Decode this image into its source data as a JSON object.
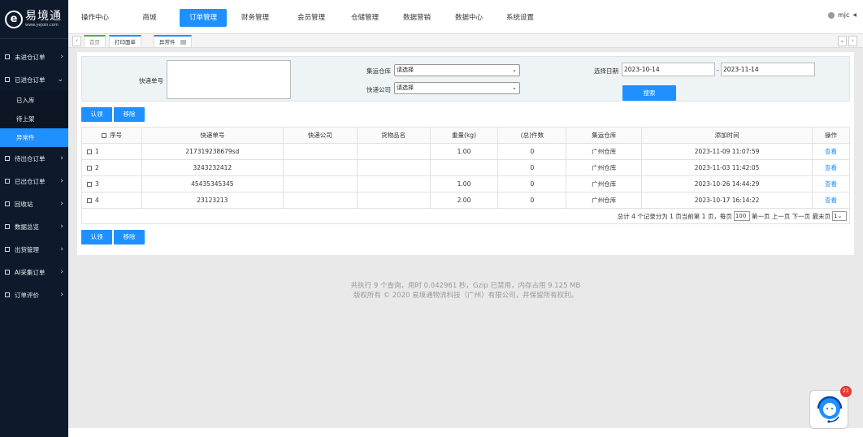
{
  "brand": {
    "name": "易境通",
    "url": "www.yejoin.com",
    "mark": "e"
  },
  "sidebar": {
    "items": [
      {
        "label": "未进仓订单"
      },
      {
        "label": "已进仓订单",
        "expanded": true,
        "subitems": [
          {
            "label": "已入库"
          },
          {
            "label": "待上架"
          },
          {
            "label": "异常件",
            "active": true
          }
        ]
      },
      {
        "label": "待出仓订单"
      },
      {
        "label": "已出仓订单"
      },
      {
        "label": "回收站"
      },
      {
        "label": "数据总览"
      },
      {
        "label": "出货管理"
      },
      {
        "label": "AI采集订单"
      },
      {
        "label": "订单评价"
      }
    ]
  },
  "topnav": {
    "items": [
      "操作中心",
      "商城",
      "订单管理",
      "财务管理",
      "会员管理",
      "仓储管理",
      "数据营销",
      "数据中心",
      "系统设置"
    ],
    "active": "订单管理"
  },
  "user": {
    "name": "mjc"
  },
  "tabs": {
    "home": "首页",
    "items": [
      "打印面单",
      "异常件"
    ]
  },
  "filter": {
    "tracking_label": "快递单号",
    "warehouse_label": "集运仓库",
    "warehouse_value": "请选择",
    "courier_label": "快递公司",
    "courier_value": "请选择",
    "date_label": "选择日期",
    "date_from": "2023-10-14",
    "date_sep": "-",
    "date_to": "2023-11-14",
    "search_label": "搜索"
  },
  "actions": {
    "claim": "认领",
    "remove": "移除"
  },
  "table": {
    "columns": [
      "序号",
      "快递单号",
      "快递公司",
      "货物品名",
      "重量(kg)",
      "(总)件数",
      "集运仓库",
      "添加时间",
      "操作"
    ],
    "rows": [
      {
        "no": "1",
        "tracking": "217319238679sd",
        "courier": "",
        "goods": "",
        "weight": "1.00",
        "count": "0",
        "warehouse": "广州仓库",
        "time": "2023-11-09 11:07:59",
        "action": "查看"
      },
      {
        "no": "2",
        "tracking": "3243232412",
        "courier": "",
        "goods": "",
        "weight": "",
        "count": "0",
        "warehouse": "广州仓库",
        "time": "2023-11-03 11:42:05",
        "action": "查看"
      },
      {
        "no": "3",
        "tracking": "45435345345",
        "courier": "",
        "goods": "",
        "weight": "1.00",
        "count": "0",
        "warehouse": "广州仓库",
        "time": "2023-10-26 14:44:29",
        "action": "查看"
      },
      {
        "no": "4",
        "tracking": "23123213",
        "courier": "",
        "goods": "",
        "weight": "2.00",
        "count": "0",
        "warehouse": "广州仓库",
        "time": "2023-10-17 16:14:22",
        "action": "查看"
      }
    ]
  },
  "pager": {
    "summary": "总计 4 个记录分为 1 页当前第 1 页，每页",
    "page_size": "100",
    "links": "第一页 上一页 下一页 最末页",
    "page": "1"
  },
  "footer": {
    "line1": "共执行 9 个查询，用时 0.042961 秒，Gzip 已禁用，内存占用 9.125 MB",
    "line2": "版权所有 © 2020 易境通物流科技（广州）有限公司，并保留所有权利。"
  },
  "support": {
    "badge": "21"
  }
}
